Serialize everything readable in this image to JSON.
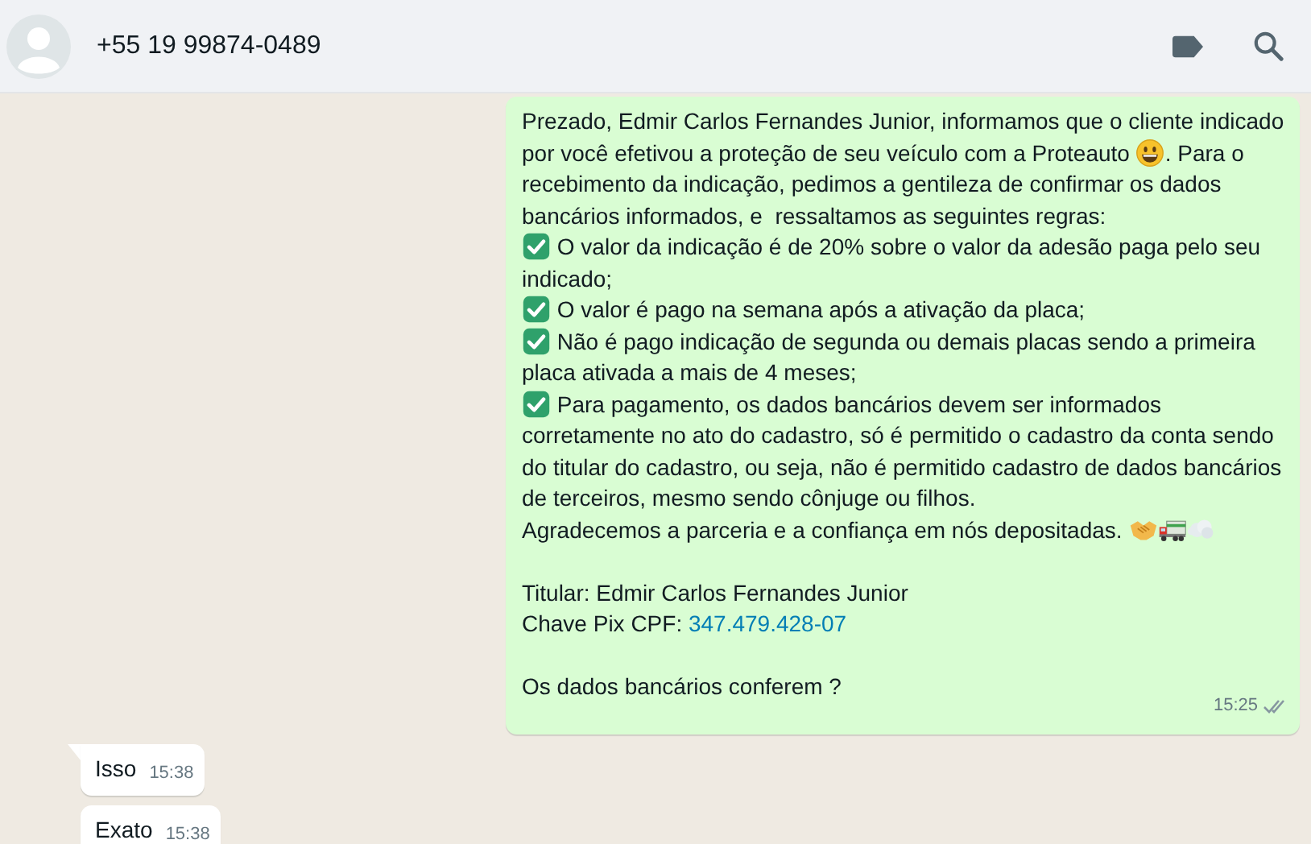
{
  "header": {
    "contact": "+55 19 99874-0489"
  },
  "messages": [
    {
      "outgoing": true,
      "tail": false,
      "time": "15:25",
      "read": false,
      "paragraphs": [
        {
          "kind": "line",
          "parts": [
            {
              "kind": "text",
              "text": "Prezado, Edmir Carlos Fernandes Junior, informamos que o cliente indicado por você efetivou a proteção de seu veículo com a Proteauto "
            },
            {
              "kind": "smiley"
            },
            {
              "kind": "text",
              "text": ". Para o recebimento da indicação, pedimos a gentileza de confirmar os dados bancários informados, e  ressaltamos as seguintes regras:"
            }
          ]
        },
        {
          "kind": "line",
          "parts": [
            {
              "kind": "check"
            },
            {
              "kind": "text",
              "text": " O valor da indicação é de 20% sobre o valor da adesão paga pelo seu indicado;"
            }
          ]
        },
        {
          "kind": "line",
          "parts": [
            {
              "kind": "check"
            },
            {
              "kind": "text",
              "text": " O valor é pago na semana após a ativação da placa;"
            }
          ]
        },
        {
          "kind": "line",
          "parts": [
            {
              "kind": "check"
            },
            {
              "kind": "text",
              "text": " Não é pago indicação de segunda ou demais placas sendo a primeira placa ativada a mais de 4 meses;"
            }
          ]
        },
        {
          "kind": "line",
          "parts": [
            {
              "kind": "check"
            },
            {
              "kind": "text",
              "text": " Para pagamento, os dados bancários devem ser informados corretamente no ato do cadastro, só é permitido o cadastro da conta sendo do titular do cadastro, ou seja, não é permitido cadastro de dados bancários de terceiros, mesmo sendo cônjuge ou filhos."
            }
          ]
        },
        {
          "kind": "line",
          "parts": [
            {
              "kind": "text",
              "text": "Agradecemos a parceria e a confiança em nós depositadas. "
            },
            {
              "kind": "handshake"
            },
            {
              "kind": "truck"
            },
            {
              "kind": "dash"
            }
          ]
        },
        {
          "kind": "blank"
        },
        {
          "kind": "line",
          "parts": [
            {
              "kind": "text",
              "text": "Titular: Edmir Carlos Fernandes Junior"
            }
          ]
        },
        {
          "kind": "line",
          "parts": [
            {
              "kind": "text",
              "text": "Chave Pix CPF: "
            },
            {
              "kind": "link",
              "text": "347.479.428-07"
            }
          ]
        },
        {
          "kind": "blank"
        },
        {
          "kind": "line",
          "parts": [
            {
              "kind": "text",
              "text": "Os dados bancários conferem ?"
            }
          ]
        }
      ]
    },
    {
      "outgoing": false,
      "tail": true,
      "time": "15:38",
      "paragraphs": [
        {
          "kind": "line",
          "parts": [
            {
              "kind": "text",
              "text": "Isso"
            }
          ]
        }
      ]
    },
    {
      "outgoing": false,
      "tail": false,
      "time": "15:38",
      "paragraphs": [
        {
          "kind": "line",
          "parts": [
            {
              "kind": "text",
              "text": "Exato"
            }
          ]
        }
      ]
    }
  ]
}
